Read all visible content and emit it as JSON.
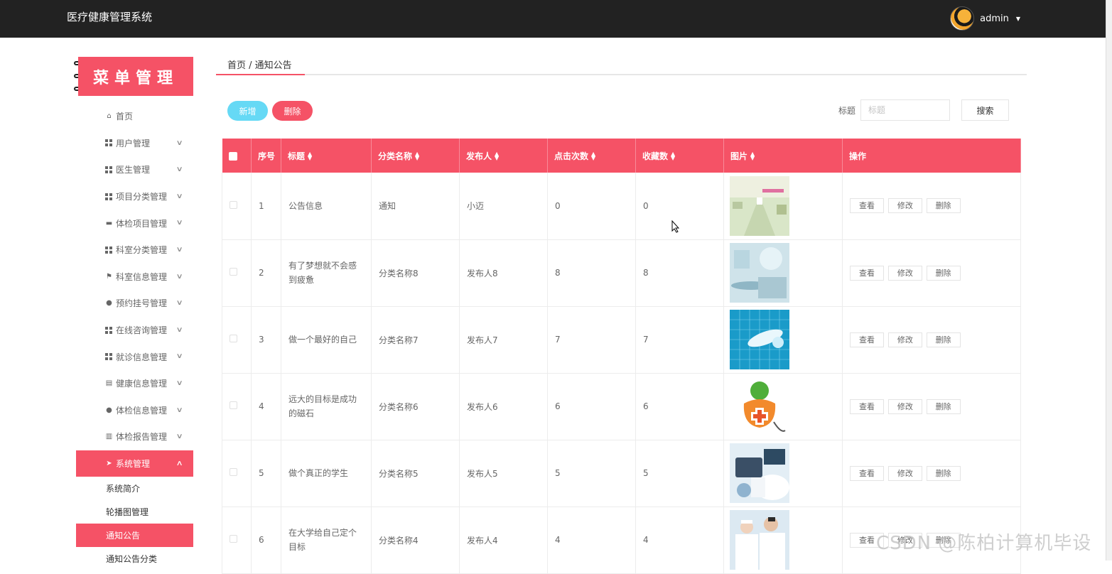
{
  "header": {
    "app_title": "医疗健康管理系统",
    "username": "admin"
  },
  "sidebar": {
    "banner": "菜单管理",
    "items": [
      {
        "label": "首页",
        "icon": "home-icon"
      },
      {
        "label": "用户管理",
        "icon": "grid-icon"
      },
      {
        "label": "医生管理",
        "icon": "grid-icon"
      },
      {
        "label": "项目分类管理",
        "icon": "grid-icon"
      },
      {
        "label": "体检项目管理",
        "icon": "briefcase-icon"
      },
      {
        "label": "科室分类管理",
        "icon": "grid-icon"
      },
      {
        "label": "科室信息管理",
        "icon": "flag-icon"
      },
      {
        "label": "预约挂号管理",
        "icon": "user-icon"
      },
      {
        "label": "在线咨询管理",
        "icon": "grid-icon"
      },
      {
        "label": "就诊信息管理",
        "icon": "grid-icon"
      },
      {
        "label": "健康信息管理",
        "icon": "clipboard-icon"
      },
      {
        "label": "体检信息管理",
        "icon": "pin-icon"
      },
      {
        "label": "体检报告管理",
        "icon": "chart-icon"
      },
      {
        "label": "系统管理",
        "icon": "send-icon"
      }
    ],
    "sub_items": [
      {
        "label": "系统简介"
      },
      {
        "label": "轮播图管理"
      },
      {
        "label": "通知公告"
      },
      {
        "label": "通知公告分类"
      }
    ]
  },
  "breadcrumb": {
    "text": "首页 / 通知公告"
  },
  "toolbar": {
    "new_label": "新增",
    "delete_label": "删除",
    "search_label": "标题",
    "search_placeholder": "标题",
    "search_button": "搜索"
  },
  "table": {
    "headers": [
      "序号",
      "标题",
      "分类名称",
      "发布人",
      "点击次数",
      "收藏数",
      "图片",
      "操作"
    ],
    "rows": [
      {
        "no": "1",
        "title": "公告信息",
        "category": "通知",
        "publisher": "小迈",
        "clicks": "0",
        "favorites": "0",
        "image": "hospital-corridor"
      },
      {
        "no": "2",
        "title": "有了梦想就不会感到疲惫",
        "category": "分类名称8",
        "publisher": "发布人8",
        "clicks": "8",
        "favorites": "8",
        "image": "medical-tech"
      },
      {
        "no": "3",
        "title": "做一个最好的自己",
        "category": "分类名称7",
        "publisher": "发布人7",
        "clicks": "7",
        "favorites": "7",
        "image": "medical-grid"
      },
      {
        "no": "4",
        "title": "远大的目标是成功的磁石",
        "category": "分类名称6",
        "publisher": "发布人6",
        "clicks": "6",
        "favorites": "6",
        "image": "health-apple"
      },
      {
        "no": "5",
        "title": "做个真正的学生",
        "category": "分类名称5",
        "publisher": "发布人5",
        "clicks": "5",
        "favorites": "5",
        "image": "doctor-tablet"
      },
      {
        "no": "6",
        "title": "在大学给自己定个目标",
        "category": "分类名称4",
        "publisher": "发布人4",
        "clicks": "4",
        "favorites": "4",
        "image": "doctors"
      }
    ],
    "actions": {
      "view": "查看",
      "edit": "修改",
      "delete": "删除"
    }
  },
  "watermark": "CSDN @陈柏计算机毕设",
  "colors": {
    "accent": "#f55266",
    "new_button": "#66d9f5",
    "topbar": "#222222"
  }
}
